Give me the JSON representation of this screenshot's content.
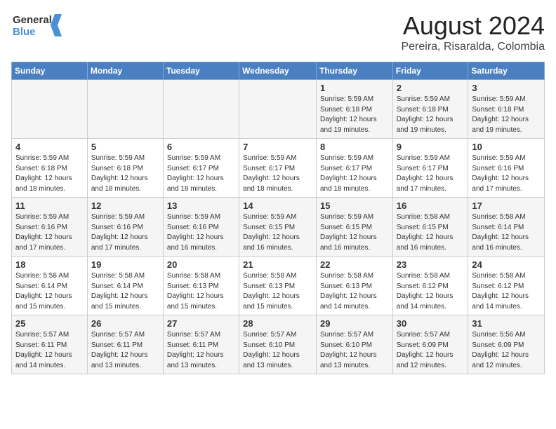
{
  "header": {
    "logo_line1": "General",
    "logo_line2": "Blue",
    "month": "August 2024",
    "location": "Pereira, Risaralda, Colombia"
  },
  "days_of_week": [
    "Sunday",
    "Monday",
    "Tuesday",
    "Wednesday",
    "Thursday",
    "Friday",
    "Saturday"
  ],
  "weeks": [
    [
      {
        "num": "",
        "info": ""
      },
      {
        "num": "",
        "info": ""
      },
      {
        "num": "",
        "info": ""
      },
      {
        "num": "",
        "info": ""
      },
      {
        "num": "1",
        "info": "Sunrise: 5:59 AM\nSunset: 6:18 PM\nDaylight: 12 hours\nand 19 minutes."
      },
      {
        "num": "2",
        "info": "Sunrise: 5:59 AM\nSunset: 6:18 PM\nDaylight: 12 hours\nand 19 minutes."
      },
      {
        "num": "3",
        "info": "Sunrise: 5:59 AM\nSunset: 6:18 PM\nDaylight: 12 hours\nand 19 minutes."
      }
    ],
    [
      {
        "num": "4",
        "info": "Sunrise: 5:59 AM\nSunset: 6:18 PM\nDaylight: 12 hours\nand 18 minutes."
      },
      {
        "num": "5",
        "info": "Sunrise: 5:59 AM\nSunset: 6:18 PM\nDaylight: 12 hours\nand 18 minutes."
      },
      {
        "num": "6",
        "info": "Sunrise: 5:59 AM\nSunset: 6:17 PM\nDaylight: 12 hours\nand 18 minutes."
      },
      {
        "num": "7",
        "info": "Sunrise: 5:59 AM\nSunset: 6:17 PM\nDaylight: 12 hours\nand 18 minutes."
      },
      {
        "num": "8",
        "info": "Sunrise: 5:59 AM\nSunset: 6:17 PM\nDaylight: 12 hours\nand 18 minutes."
      },
      {
        "num": "9",
        "info": "Sunrise: 5:59 AM\nSunset: 6:17 PM\nDaylight: 12 hours\nand 17 minutes."
      },
      {
        "num": "10",
        "info": "Sunrise: 5:59 AM\nSunset: 6:16 PM\nDaylight: 12 hours\nand 17 minutes."
      }
    ],
    [
      {
        "num": "11",
        "info": "Sunrise: 5:59 AM\nSunset: 6:16 PM\nDaylight: 12 hours\nand 17 minutes."
      },
      {
        "num": "12",
        "info": "Sunrise: 5:59 AM\nSunset: 6:16 PM\nDaylight: 12 hours\nand 17 minutes."
      },
      {
        "num": "13",
        "info": "Sunrise: 5:59 AM\nSunset: 6:16 PM\nDaylight: 12 hours\nand 16 minutes."
      },
      {
        "num": "14",
        "info": "Sunrise: 5:59 AM\nSunset: 6:15 PM\nDaylight: 12 hours\nand 16 minutes."
      },
      {
        "num": "15",
        "info": "Sunrise: 5:59 AM\nSunset: 6:15 PM\nDaylight: 12 hours\nand 16 minutes."
      },
      {
        "num": "16",
        "info": "Sunrise: 5:58 AM\nSunset: 6:15 PM\nDaylight: 12 hours\nand 16 minutes."
      },
      {
        "num": "17",
        "info": "Sunrise: 5:58 AM\nSunset: 6:14 PM\nDaylight: 12 hours\nand 16 minutes."
      }
    ],
    [
      {
        "num": "18",
        "info": "Sunrise: 5:58 AM\nSunset: 6:14 PM\nDaylight: 12 hours\nand 15 minutes."
      },
      {
        "num": "19",
        "info": "Sunrise: 5:58 AM\nSunset: 6:14 PM\nDaylight: 12 hours\nand 15 minutes."
      },
      {
        "num": "20",
        "info": "Sunrise: 5:58 AM\nSunset: 6:13 PM\nDaylight: 12 hours\nand 15 minutes."
      },
      {
        "num": "21",
        "info": "Sunrise: 5:58 AM\nSunset: 6:13 PM\nDaylight: 12 hours\nand 15 minutes."
      },
      {
        "num": "22",
        "info": "Sunrise: 5:58 AM\nSunset: 6:13 PM\nDaylight: 12 hours\nand 14 minutes."
      },
      {
        "num": "23",
        "info": "Sunrise: 5:58 AM\nSunset: 6:12 PM\nDaylight: 12 hours\nand 14 minutes."
      },
      {
        "num": "24",
        "info": "Sunrise: 5:58 AM\nSunset: 6:12 PM\nDaylight: 12 hours\nand 14 minutes."
      }
    ],
    [
      {
        "num": "25",
        "info": "Sunrise: 5:57 AM\nSunset: 6:11 PM\nDaylight: 12 hours\nand 14 minutes."
      },
      {
        "num": "26",
        "info": "Sunrise: 5:57 AM\nSunset: 6:11 PM\nDaylight: 12 hours\nand 13 minutes."
      },
      {
        "num": "27",
        "info": "Sunrise: 5:57 AM\nSunset: 6:11 PM\nDaylight: 12 hours\nand 13 minutes."
      },
      {
        "num": "28",
        "info": "Sunrise: 5:57 AM\nSunset: 6:10 PM\nDaylight: 12 hours\nand 13 minutes."
      },
      {
        "num": "29",
        "info": "Sunrise: 5:57 AM\nSunset: 6:10 PM\nDaylight: 12 hours\nand 13 minutes."
      },
      {
        "num": "30",
        "info": "Sunrise: 5:57 AM\nSunset: 6:09 PM\nDaylight: 12 hours\nand 12 minutes."
      },
      {
        "num": "31",
        "info": "Sunrise: 5:56 AM\nSunset: 6:09 PM\nDaylight: 12 hours\nand 12 minutes."
      }
    ]
  ]
}
